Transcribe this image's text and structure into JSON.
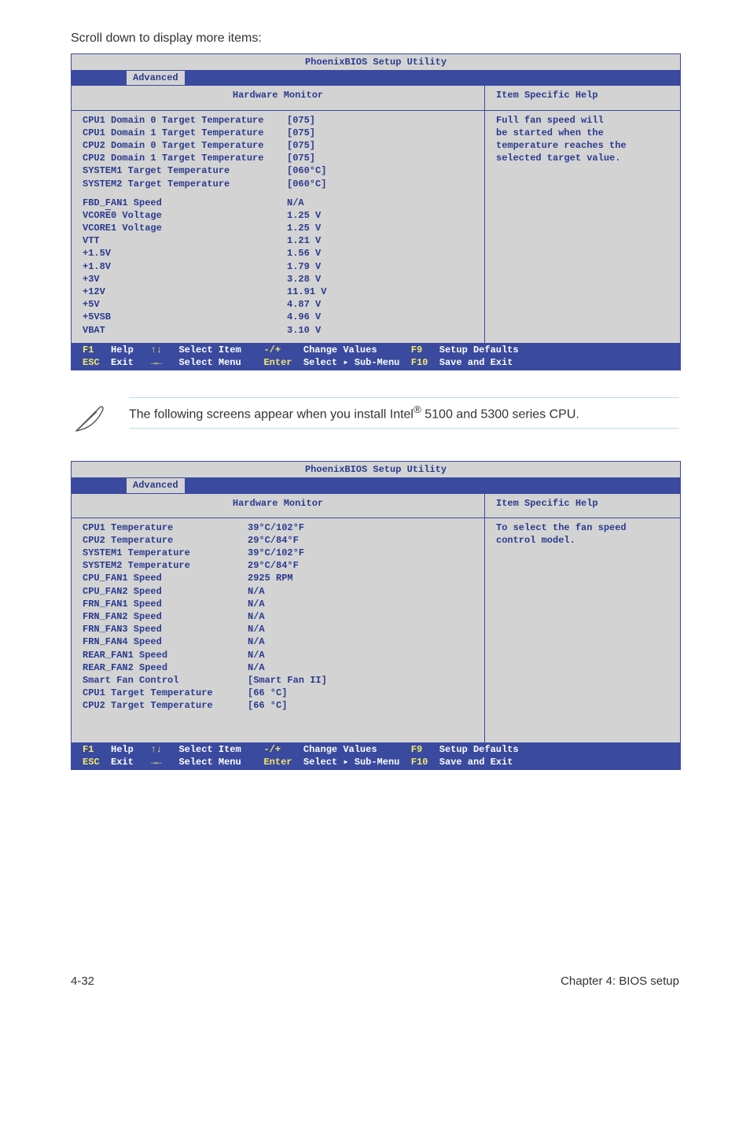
{
  "intro_text": "Scroll down to display more items:",
  "bios_common": {
    "title": "PhoenixBIOS Setup Utility",
    "tab": "Advanced",
    "hw_header": "Hardware Monitor",
    "help_header": "Item Specific Help",
    "footer": {
      "f1": "F1",
      "help": "Help",
      "updown": "↑↓",
      "select_item": "Select Item",
      "plusminus": "-/+",
      "change_values": "Change Values",
      "f9": "F9",
      "setup_defaults": "Setup Defaults",
      "esc": "ESC",
      "exit": "Exit",
      "arrows": "→←",
      "select_menu": "Select Menu",
      "enter": "Enter",
      "select_submenu": "Select ▸ Sub-Menu",
      "f10": "F10",
      "save_exit": "Save and Exit"
    }
  },
  "bios1": {
    "help": "Full fan speed will\nbe started when the\ntemperature reaches the\nselected target value.",
    "group1": [
      {
        "label": "CPU1 Domain 0 Target Temperature",
        "value": "[075]"
      },
      {
        "label": "CPU1 Domain 1 Target Temperature",
        "value": "[075]"
      },
      {
        "label": "CPU2 Domain 0 Target Temperature",
        "value": "[075]"
      },
      {
        "label": "CPU2 Domain 1 Target Temperature",
        "value": "[075]"
      },
      {
        "label": "SYSTEM1 Target Temperature",
        "value": "[060°C]"
      },
      {
        "label": "SYSTEM2 Target Temperature",
        "value": "[060°C]"
      }
    ],
    "group2": [
      {
        "label": "FBD_FAN1 Speed",
        "value": "N/A"
      },
      {
        "label": "VCORE0 Voltage",
        "value": "1.25 V",
        "has_underline_o": true
      },
      {
        "label": "VCORE1 Voltage",
        "value": "1.25 V"
      },
      {
        "label": "VTT",
        "value": "1.21 V"
      },
      {
        "label": "+1.5V",
        "value": "1.56 V"
      },
      {
        "label": "+1.8V",
        "value": "1.79 V"
      },
      {
        "label": "+3V",
        "value": "3.28 V"
      },
      {
        "label": "+12V",
        "value": "11.91 V"
      },
      {
        "label": "+5V",
        "value": "4.87 V"
      },
      {
        "label": "+5VSB",
        "value": "4.96 V"
      },
      {
        "label": "VBAT",
        "value": "3.10 V"
      }
    ]
  },
  "note": {
    "prefix": "The following screens appear when you install Intel",
    "suffix": " 5100 and 5300 series CPU."
  },
  "bios2": {
    "help": "To select the fan speed\ncontrol model.",
    "rows": [
      {
        "label": "CPU1 Temperature",
        "value": "39°C/102°F"
      },
      {
        "label": "CPU2 Temperature",
        "value": "29°C/84°F"
      },
      {
        "label": "SYSTEM1 Temperature",
        "value": "39°C/102°F"
      },
      {
        "label": "SYSTEM2 Temperature",
        "value": "29°C/84°F"
      },
      {
        "label": "CPU_FAN1 Speed",
        "value": "2925 RPM"
      },
      {
        "label": "CPU_FAN2 Speed",
        "value": "N/A"
      },
      {
        "label": "FRN_FAN1 Speed",
        "value": "N/A"
      },
      {
        "label": "FRN_FAN2 Speed",
        "value": "N/A"
      },
      {
        "label": "FRN_FAN3 Speed",
        "value": "N/A"
      },
      {
        "label": "FRN_FAN4 Speed",
        "value": "N/A"
      },
      {
        "label": "REAR_FAN1 Speed",
        "value": "N/A"
      },
      {
        "label": "REAR_FAN2 Speed",
        "value": "N/A"
      },
      {
        "label": "Smart Fan Control",
        "value": "[Smart Fan II]"
      },
      {
        "label": "CPU1 Target Temperature",
        "value": "[66 °C]"
      },
      {
        "label": "CPU2 Target Temperature",
        "value": "[66 °C]"
      }
    ]
  },
  "footer": {
    "left": "4-32",
    "right": "Chapter 4: BIOS setup"
  }
}
